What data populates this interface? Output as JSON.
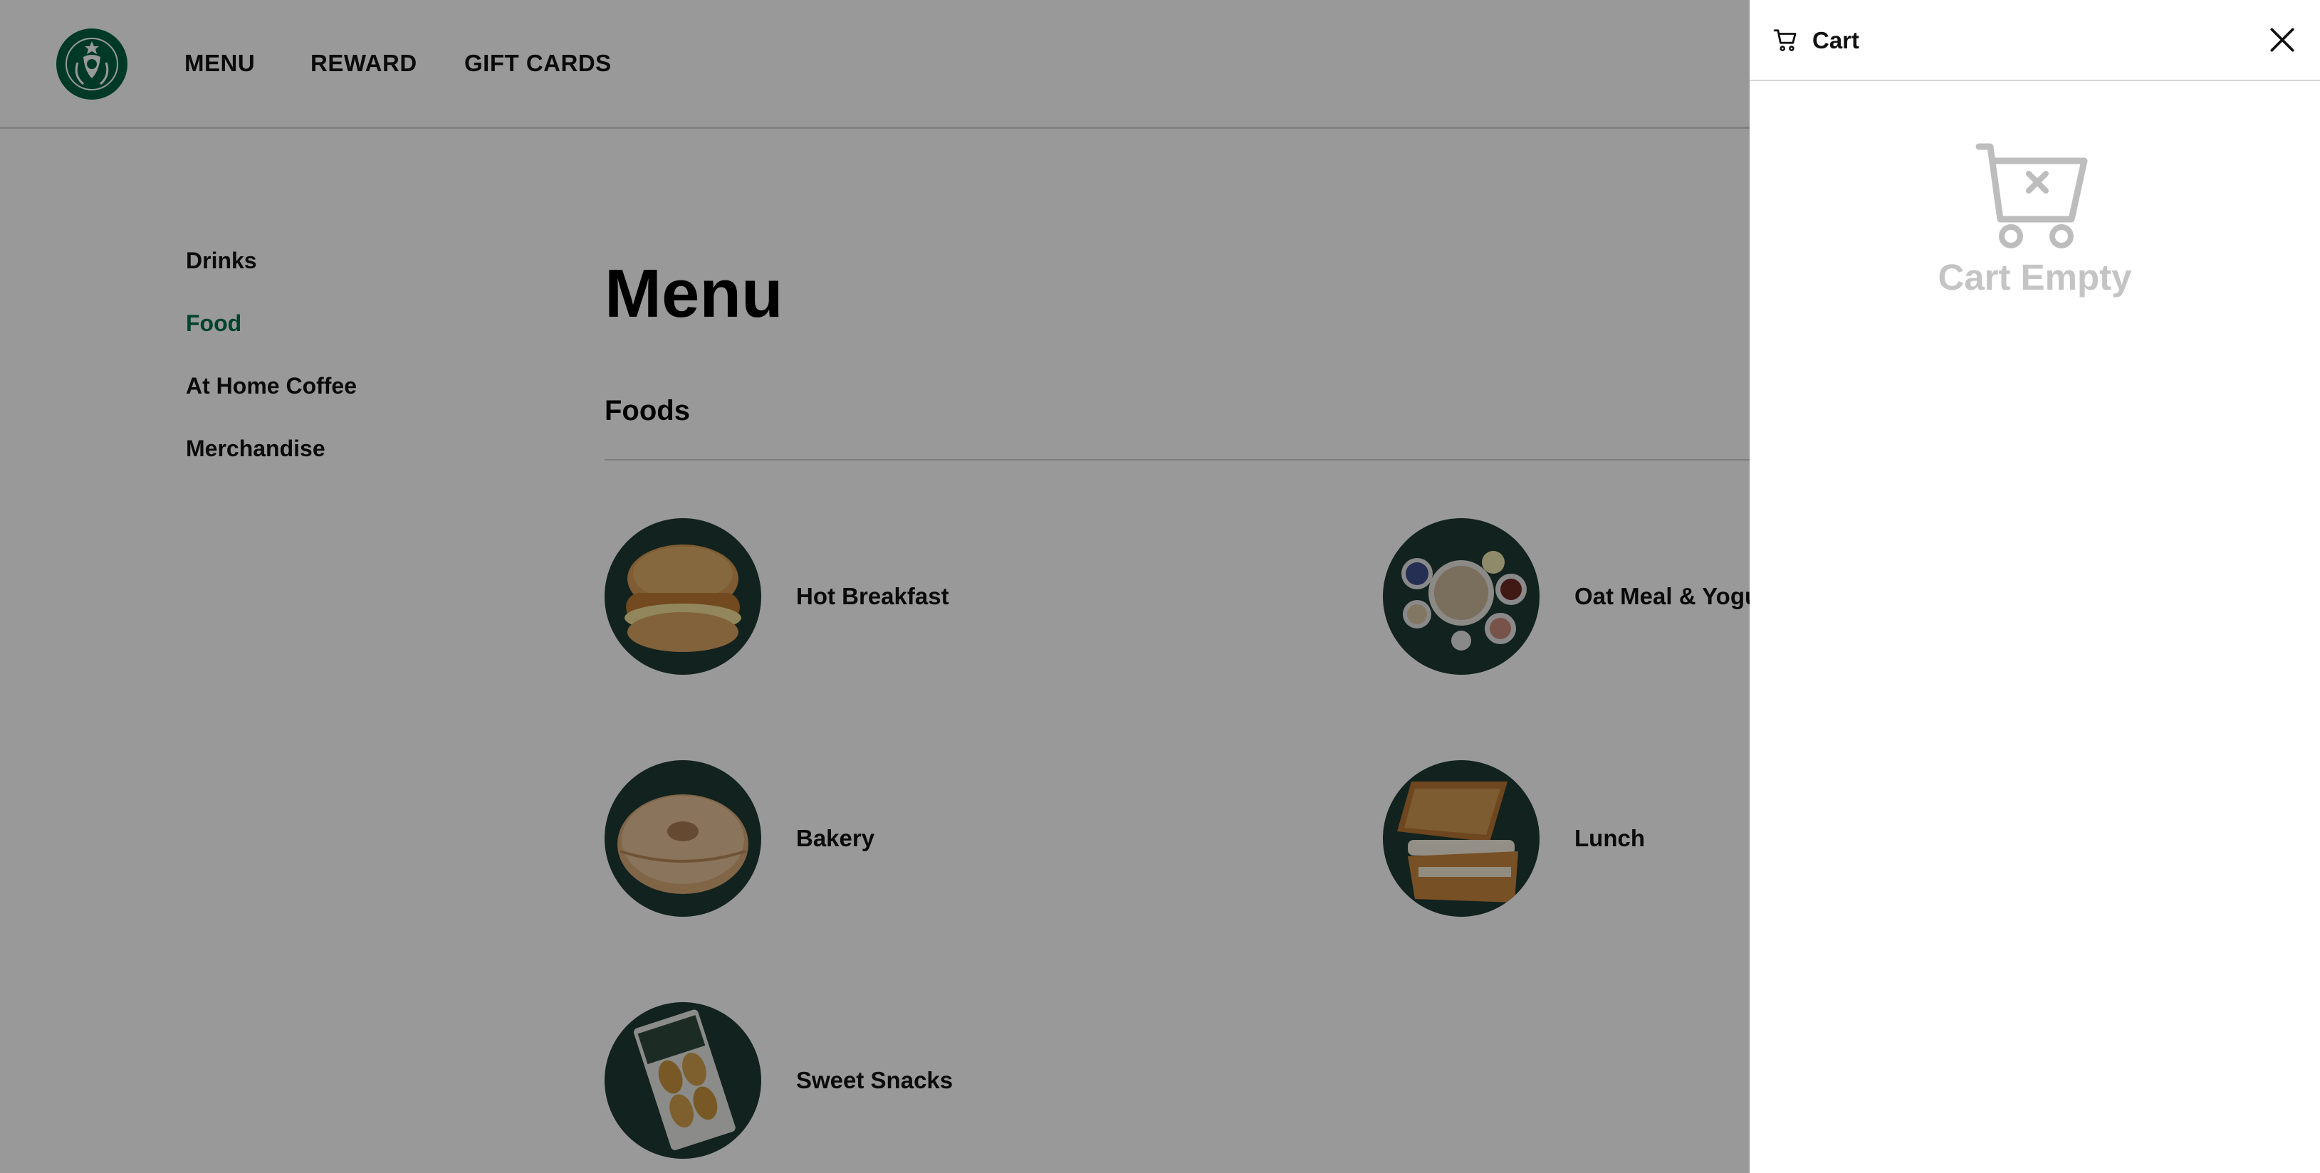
{
  "header": {
    "nav": [
      {
        "label": "MENU"
      },
      {
        "label": "REWARD"
      },
      {
        "label": "GIFT CARDS"
      }
    ]
  },
  "sidebar": {
    "items": [
      {
        "label": "Drinks",
        "active": false
      },
      {
        "label": "Food",
        "active": true
      },
      {
        "label": "At Home Coffee",
        "active": false
      },
      {
        "label": "Merchandise",
        "active": false
      }
    ]
  },
  "main": {
    "title": "Menu",
    "section": "Foods",
    "categories": [
      {
        "label": "Hot Breakfast",
        "image": "sandwich"
      },
      {
        "label": "Oat Meal & Yogu",
        "image": "oatmeal-bowls"
      },
      {
        "label": "Bakery",
        "image": "bagel"
      },
      {
        "label": "Lunch",
        "image": "grilled-sandwich"
      },
      {
        "label": "Sweet Snacks",
        "image": "madeleines-pack"
      }
    ]
  },
  "cart": {
    "title": "Cart",
    "empty_text": "Cart Empty"
  },
  "colors": {
    "brand_green": "#006241",
    "active_green": "#00704a",
    "image_bg": "#1f3933",
    "empty_gray": "#c4c4c4"
  }
}
